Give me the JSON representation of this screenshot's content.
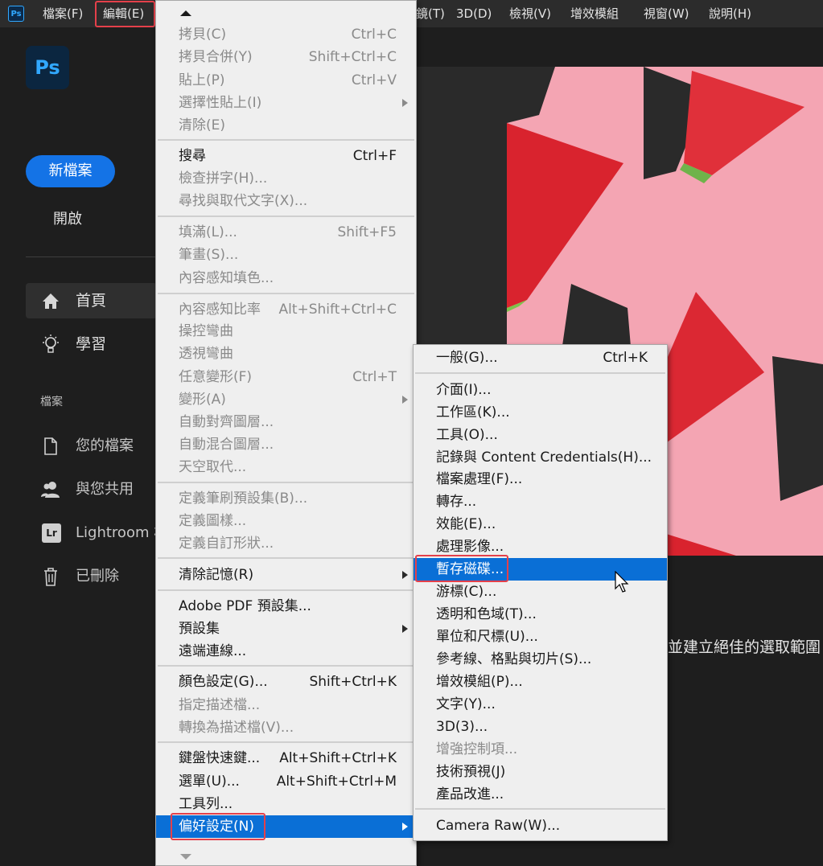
{
  "menubar": {
    "app_icon": "Ps",
    "items": [
      "檔案(F)",
      "編輯(E)",
      "鏡(T)",
      "3D(D)",
      "檢視(V)",
      "增效模組",
      "視窗(W)",
      "說明(H)"
    ]
  },
  "home": {
    "logo": "Ps",
    "new_file": "新檔案",
    "open": "開啟",
    "nav": [
      {
        "label": "首頁",
        "icon": "home-icon"
      },
      {
        "label": "學習",
        "icon": "lightbulb-icon"
      }
    ],
    "files_section": "檔案",
    "files": [
      {
        "label": "您的檔案",
        "icon": "document-icon"
      },
      {
        "label": "與您共用",
        "icon": "shared-users-icon"
      },
      {
        "label": "Lightroom 相",
        "icon": "lightroom-icon",
        "badge": "Lr"
      },
      {
        "label": "已刪除",
        "icon": "trash-icon"
      }
    ],
    "promo_text": "並建立絕佳的選取範圍"
  },
  "edit_menu": {
    "items": [
      {
        "label": "拷貝(C)",
        "shortcut": "Ctrl+C",
        "disabled": true
      },
      {
        "label": "拷貝合併(Y)",
        "shortcut": "Shift+Ctrl+C",
        "disabled": true
      },
      {
        "label": "貼上(P)",
        "shortcut": "Ctrl+V",
        "disabled": true
      },
      {
        "label": "選擇性貼上(I)",
        "shortcut": "",
        "disabled": true,
        "submenu": true
      },
      {
        "label": "清除(E)",
        "shortcut": "",
        "disabled": true
      },
      {
        "label": "搜尋",
        "shortcut": "Ctrl+F",
        "disabled": false
      },
      {
        "label": "檢查拼字(H)...",
        "shortcut": "",
        "disabled": true
      },
      {
        "label": "尋找與取代文字(X)...",
        "shortcut": "",
        "disabled": true
      },
      {
        "label": "填滿(L)...",
        "shortcut": "Shift+F5",
        "disabled": true
      },
      {
        "label": "筆畫(S)...",
        "shortcut": "",
        "disabled": true
      },
      {
        "label": "內容感知填色...",
        "shortcut": "",
        "disabled": true
      },
      {
        "label": "內容感知比率",
        "shortcut": "Alt+Shift+Ctrl+C",
        "disabled": true
      },
      {
        "label": "操控彎曲",
        "shortcut": "",
        "disabled": true
      },
      {
        "label": "透視彎曲",
        "shortcut": "",
        "disabled": true
      },
      {
        "label": "任意變形(F)",
        "shortcut": "Ctrl+T",
        "disabled": true
      },
      {
        "label": "變形(A)",
        "shortcut": "",
        "disabled": true,
        "submenu": true
      },
      {
        "label": "自動對齊圖層...",
        "shortcut": "",
        "disabled": true
      },
      {
        "label": "自動混合圖層...",
        "shortcut": "",
        "disabled": true
      },
      {
        "label": "天空取代...",
        "shortcut": "",
        "disabled": true
      },
      {
        "label": "定義筆刷預設集(B)...",
        "shortcut": "",
        "disabled": true
      },
      {
        "label": "定義圖樣...",
        "shortcut": "",
        "disabled": true
      },
      {
        "label": "定義自訂形狀...",
        "shortcut": "",
        "disabled": true
      },
      {
        "label": "清除記憶(R)",
        "shortcut": "",
        "disabled": false,
        "submenu": true
      },
      {
        "label": "Adobe PDF 預設集...",
        "shortcut": "",
        "disabled": false
      },
      {
        "label": "預設集",
        "shortcut": "",
        "disabled": false,
        "submenu": true
      },
      {
        "label": "遠端連線...",
        "shortcut": "",
        "disabled": false
      },
      {
        "label": "顏色設定(G)...",
        "shortcut": "Shift+Ctrl+K",
        "disabled": false
      },
      {
        "label": "指定描述檔...",
        "shortcut": "",
        "disabled": true
      },
      {
        "label": "轉換為描述檔(V)...",
        "shortcut": "",
        "disabled": true
      },
      {
        "label": "鍵盤快速鍵...",
        "shortcut": "Alt+Shift+Ctrl+K",
        "disabled": false
      },
      {
        "label": "選單(U)...",
        "shortcut": "Alt+Shift+Ctrl+M",
        "disabled": false
      },
      {
        "label": "工具列...",
        "shortcut": "",
        "disabled": false
      },
      {
        "label": "偏好設定(N)",
        "shortcut": "",
        "disabled": false,
        "submenu": true,
        "selected": true
      }
    ]
  },
  "preferences_menu": {
    "items": [
      {
        "label": "一般(G)...",
        "shortcut": "Ctrl+K",
        "disabled": false
      },
      {
        "label": "介面(I)...",
        "shortcut": "",
        "disabled": false
      },
      {
        "label": "工作區(K)...",
        "shortcut": "",
        "disabled": false
      },
      {
        "label": "工具(O)...",
        "shortcut": "",
        "disabled": false
      },
      {
        "label": "記錄與 Content Credentials(H)...",
        "shortcut": "",
        "disabled": false
      },
      {
        "label": "檔案處理(F)...",
        "shortcut": "",
        "disabled": false
      },
      {
        "label": "轉存...",
        "shortcut": "",
        "disabled": false
      },
      {
        "label": "效能(E)...",
        "shortcut": "",
        "disabled": false
      },
      {
        "label": "處理影像...",
        "shortcut": "",
        "disabled": false
      },
      {
        "label": "暫存磁碟...",
        "shortcut": "",
        "disabled": false,
        "selected": true
      },
      {
        "label": "游標(C)...",
        "shortcut": "",
        "disabled": false
      },
      {
        "label": "透明和色域(T)...",
        "shortcut": "",
        "disabled": false
      },
      {
        "label": "單位和尺標(U)...",
        "shortcut": "",
        "disabled": false
      },
      {
        "label": "參考線、格點與切片(S)...",
        "shortcut": "",
        "disabled": false
      },
      {
        "label": "增效模組(P)...",
        "shortcut": "",
        "disabled": false
      },
      {
        "label": "文字(Y)...",
        "shortcut": "",
        "disabled": false
      },
      {
        "label": "3D(3)...",
        "shortcut": "",
        "disabled": false
      },
      {
        "label": "增強控制項...",
        "shortcut": "",
        "disabled": true
      },
      {
        "label": "技術預視(J)",
        "shortcut": "",
        "disabled": false
      },
      {
        "label": "產品改進...",
        "shortcut": "",
        "disabled": false
      },
      {
        "label": "Camera Raw(W)...",
        "shortcut": "",
        "disabled": false
      }
    ]
  },
  "colors": {
    "accent": "#0a6fd6",
    "highlight_box": "#e4404a",
    "photo_background": "#f4a5b3"
  }
}
